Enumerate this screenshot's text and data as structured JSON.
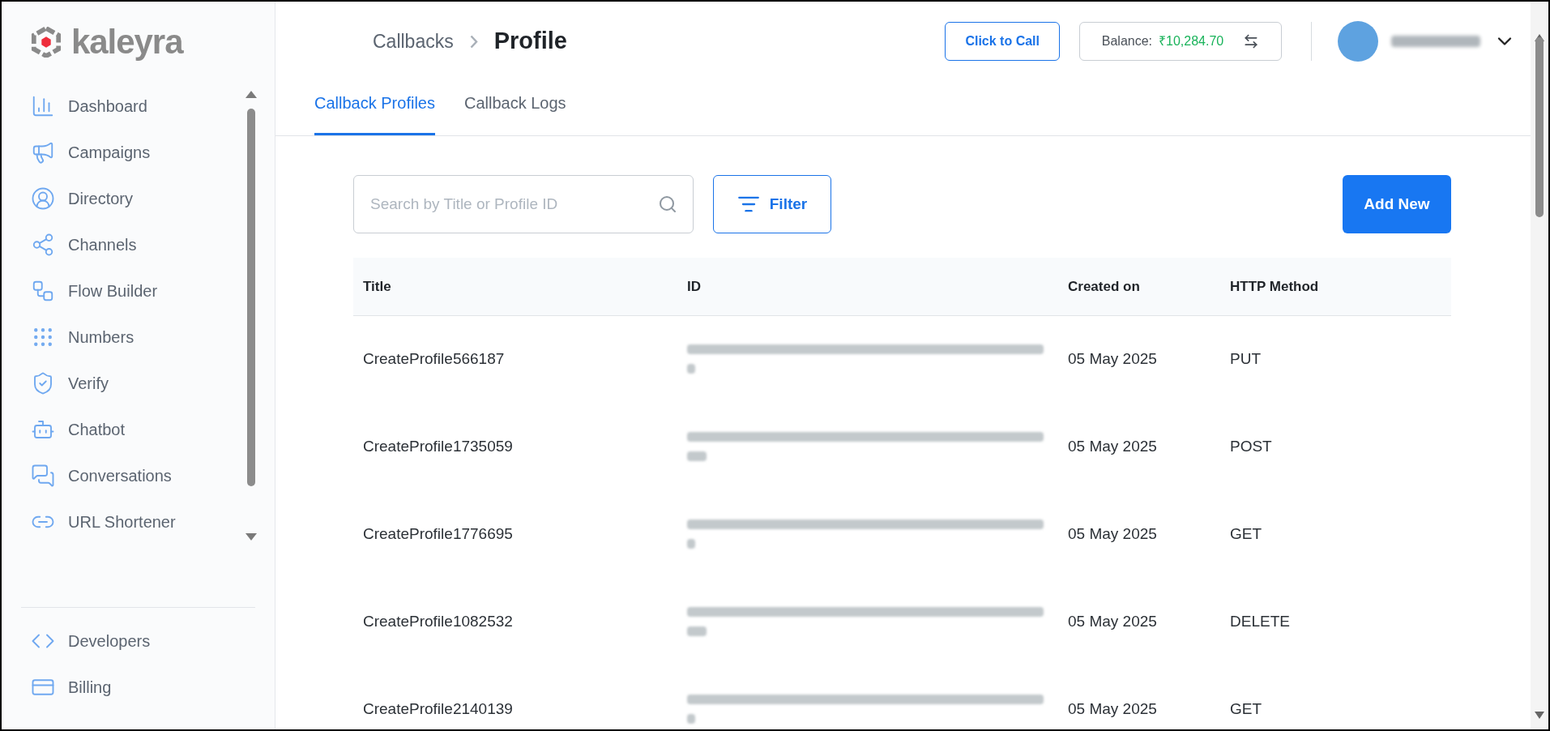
{
  "logo": {
    "text": "kaleyra"
  },
  "sidebar": {
    "items": [
      {
        "label": "Dashboard",
        "selected": false
      },
      {
        "label": "Campaigns",
        "selected": false
      },
      {
        "label": "Directory",
        "selected": false
      },
      {
        "label": "Channels",
        "selected": false
      },
      {
        "label": "Flow Builder",
        "selected": false
      },
      {
        "label": "Numbers",
        "selected": false
      },
      {
        "label": "Verify",
        "selected": false
      },
      {
        "label": "Chatbot",
        "selected": false
      },
      {
        "label": "Conversations",
        "selected": false
      },
      {
        "label": "URL Shortener",
        "selected": false
      }
    ],
    "bottom_items": [
      {
        "label": "Developers",
        "selected": false
      },
      {
        "label": "Billing",
        "selected": false
      }
    ]
  },
  "breadcrumb": {
    "parent": "Callbacks",
    "current": "Profile"
  },
  "header": {
    "click_to_call": "Click to Call",
    "balance_label": "Balance:",
    "balance_value": "₹10,284.70"
  },
  "tabs": [
    {
      "label": "Callback Profiles",
      "selected": true
    },
    {
      "label": "Callback Logs",
      "selected": false
    }
  ],
  "search": {
    "placeholder": "Search by Title or Profile ID"
  },
  "filter_button": "Filter",
  "add_button": "Add New",
  "table": {
    "columns": [
      "Title",
      "ID",
      "Created on",
      "HTTP Method"
    ],
    "rows": [
      {
        "title": "CreateProfile566187",
        "created": "05 May 2025",
        "method": "PUT"
      },
      {
        "title": "CreateProfile1735059",
        "created": "05 May 2025",
        "method": "POST"
      },
      {
        "title": "CreateProfile1776695",
        "created": "05 May 2025",
        "method": "GET"
      },
      {
        "title": "CreateProfile1082532",
        "created": "05 May 2025",
        "method": "DELETE"
      },
      {
        "title": "CreateProfile2140139",
        "created": "05 May 2025",
        "method": "GET"
      }
    ]
  }
}
